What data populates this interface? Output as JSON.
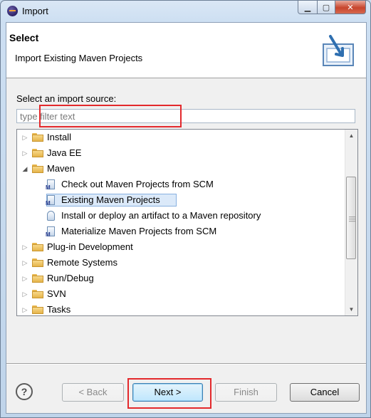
{
  "window": {
    "title": "Import"
  },
  "header": {
    "title": "Select",
    "description": "Import Existing Maven Projects"
  },
  "source_label": "Select an import source:",
  "filter": {
    "placeholder": "type filter text",
    "value": ""
  },
  "tree": {
    "items": [
      {
        "label": "Install",
        "type": "folder",
        "expanded": false
      },
      {
        "label": "Java EE",
        "type": "folder",
        "expanded": false
      },
      {
        "label": "Maven",
        "type": "folder",
        "expanded": true
      },
      {
        "label": "Check out Maven Projects from SCM",
        "type": "maven-item"
      },
      {
        "label": "Existing Maven Projects",
        "type": "maven-item",
        "selected": true
      },
      {
        "label": "Install or deploy an artifact to a Maven repository",
        "type": "maven-item"
      },
      {
        "label": "Materialize Maven Projects from SCM",
        "type": "maven-item"
      },
      {
        "label": "Plug-in Development",
        "type": "folder",
        "expanded": false
      },
      {
        "label": "Remote Systems",
        "type": "folder",
        "expanded": false
      },
      {
        "label": "Run/Debug",
        "type": "folder",
        "expanded": false
      },
      {
        "label": "SVN",
        "type": "folder",
        "expanded": false
      },
      {
        "label": "Tasks",
        "type": "folder",
        "expanded": false
      }
    ]
  },
  "buttons": {
    "help": "?",
    "back": "< Back",
    "next": "Next >",
    "finish": "Finish",
    "cancel": "Cancel"
  },
  "colors": {
    "highlight": "#e3292c",
    "selection": "#dbe9f9"
  }
}
